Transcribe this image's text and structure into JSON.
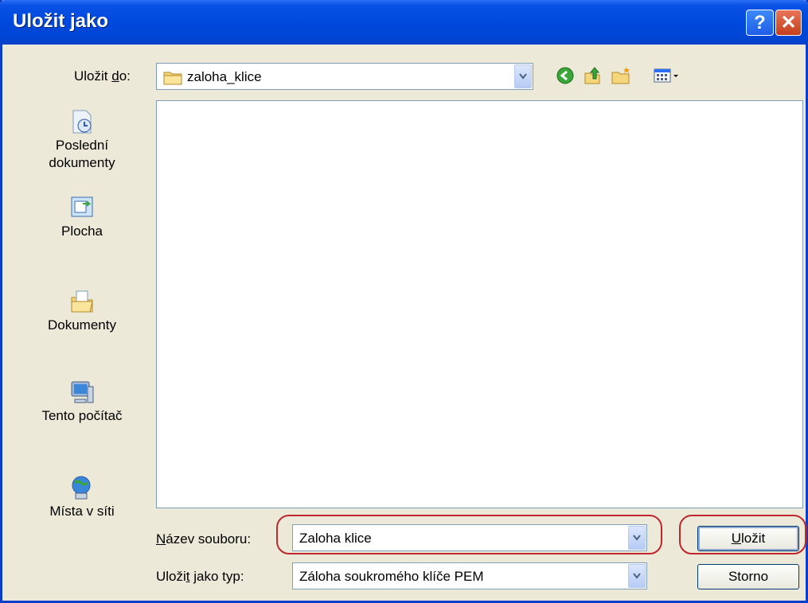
{
  "window": {
    "title": "Uložit jako",
    "help": "?",
    "close": "✕"
  },
  "location": {
    "label_pre": "Uložit ",
    "label_key": "d",
    "label_post": "o:",
    "value": "zaloha_klice"
  },
  "toolbar": {
    "back_icon": "back-icon",
    "up_icon": "up-folder-icon",
    "new_folder_icon": "new-folder-icon",
    "views_icon": "views-menu-icon"
  },
  "places": [
    {
      "label": "Poslední dokumenty",
      "icon": "recent-documents-icon"
    },
    {
      "label": "Plocha",
      "icon": "desktop-icon"
    },
    {
      "label": "Dokumenty",
      "icon": "my-documents-icon"
    },
    {
      "label": "Tento počítač",
      "icon": "my-computer-icon"
    },
    {
      "label": "Místa v síti",
      "icon": "network-places-icon"
    }
  ],
  "filename": {
    "label_key": "N",
    "label_rest": "ázev souboru:",
    "value": "Zaloha klice"
  },
  "filetype": {
    "label_pre": "Uloži",
    "label_key": "t",
    "label_post": " jako typ:",
    "value": "Záloha soukromého klíče PEM"
  },
  "buttons": {
    "save_key": "U",
    "save_rest": "ložit",
    "cancel": "Storno"
  },
  "colors": {
    "titlebar": "#0049de",
    "dialog": "#ece9d8",
    "highlight": "#c0272d"
  }
}
